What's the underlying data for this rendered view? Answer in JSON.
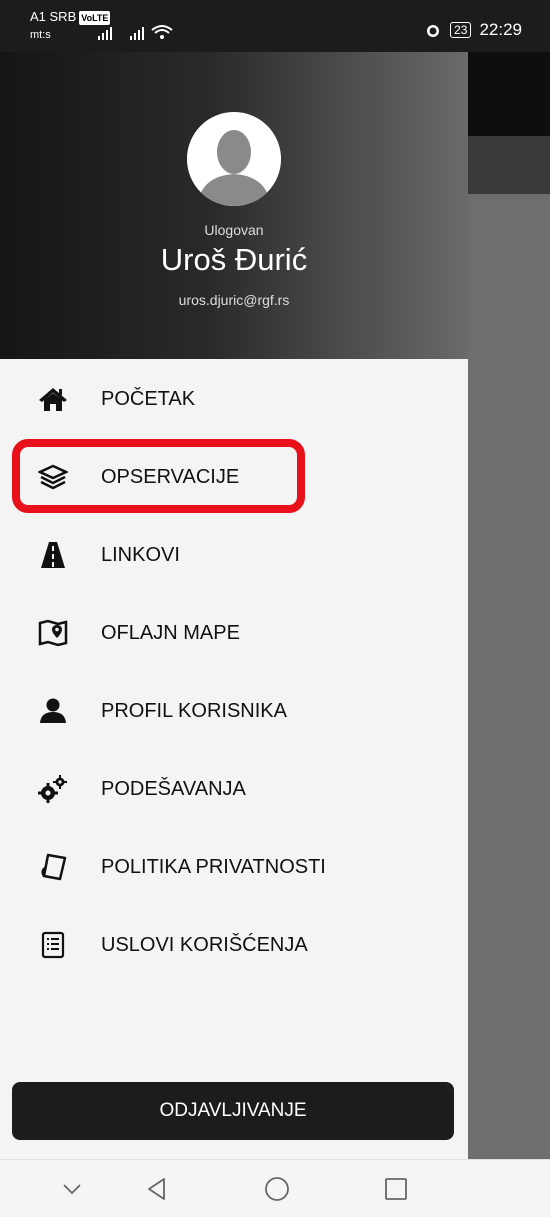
{
  "status_bar": {
    "carrier": "A1 SRB",
    "volte": "VoLTE",
    "sub_carrier": "mt:s",
    "battery": "23",
    "time": "22:29"
  },
  "drawer": {
    "logged_in_label": "Ulogovan",
    "user_name": "Uroš Đurić",
    "user_email": "uros.djuric@rgf.rs",
    "menu": [
      {
        "label": "POČETAK",
        "icon": "home-icon"
      },
      {
        "label": "OPSERVACIJE",
        "icon": "layers-icon"
      },
      {
        "label": "LINKOVI",
        "icon": "road-icon"
      },
      {
        "label": "OFLAJN MAPE",
        "icon": "map-marker-icon"
      },
      {
        "label": "PROFIL KORISNIKA",
        "icon": "user-icon"
      },
      {
        "label": "PODEŠAVANJA",
        "icon": "gears-icon"
      },
      {
        "label": "POLITIKA PRIVATNOSTI",
        "icon": "document-icon"
      },
      {
        "label": "USLOVI KORIŠĆENJA",
        "icon": "list-icon"
      }
    ],
    "logout_label": "ODJAVLJIVANJE"
  },
  "colors": {
    "highlight": "#e8101a",
    "header_dark": "#151515",
    "logout_bg": "#1c1c1c"
  }
}
